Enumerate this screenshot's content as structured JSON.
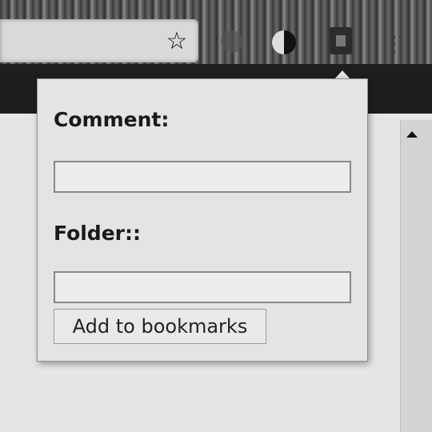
{
  "browser": {
    "icons": {
      "bookmark": "star-outline",
      "extension_1": "circle",
      "extension_2": "half-circle",
      "extension_3": "bookmark-extension",
      "menu": "vertical-dots"
    }
  },
  "popup": {
    "comment_label": "Comment:",
    "comment_value": "",
    "folder_label": "Folder::",
    "folder_value": "",
    "submit_label": "Add to bookmarks"
  },
  "colors": {
    "popup_bg": "#e4e4e4",
    "border": "#8f8f8f",
    "text": "#1a1a1a"
  }
}
